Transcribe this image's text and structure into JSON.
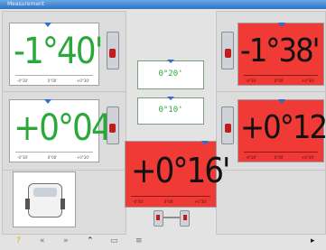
{
  "window": {
    "title": "Measurement"
  },
  "front_left": {
    "value": "-1°40'",
    "scale": [
      "-0°30'",
      "0°00'",
      "+0°30'"
    ]
  },
  "front_right": {
    "value": "-1°38'",
    "scale": [
      "-0°30'",
      "0°00'",
      "+0°30'"
    ]
  },
  "rear_left": {
    "value": "+0°04'",
    "scale": [
      "-0°30'",
      "0°00'",
      "+0°30'"
    ]
  },
  "rear_right": {
    "value": "+0°12'",
    "scale": [
      "-0°30'",
      "0°00'",
      "+0°30'"
    ]
  },
  "center": {
    "value_top": "0°20'",
    "value_bottom": "0°10'"
  },
  "thrust": {
    "value": "+0°16'",
    "scale": [
      "-0°30'",
      "0°00'",
      "+0°30'"
    ]
  },
  "toolbar": {
    "icons": [
      "help-icon",
      "rewind-icon",
      "fast-forward-icon",
      "chevrons-up-icon",
      "print-icon",
      "settings-icon",
      "next-icon"
    ]
  },
  "colors": {
    "ok": "#2aa83a",
    "alarm": "#ef3a35",
    "marker": "#2a6fd6"
  }
}
